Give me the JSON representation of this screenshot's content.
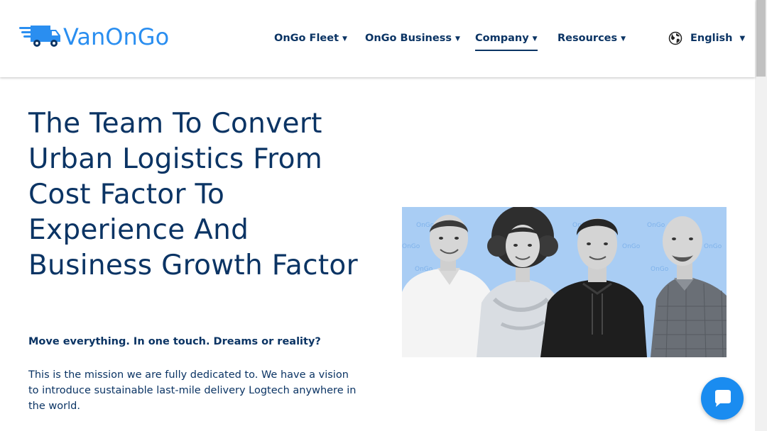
{
  "brand": {
    "name": "VanOnGo",
    "accent": "#2a8ef0",
    "dark": "#0b3464"
  },
  "nav": {
    "items": [
      {
        "label": "OnGo Fleet"
      },
      {
        "label": "OnGo Business"
      },
      {
        "label": "Company",
        "active": true
      },
      {
        "label": "Resources"
      }
    ],
    "language": "English"
  },
  "hero": {
    "title": "The Team To Convert Urban Logistics From Cost Factor To Experience And Business Growth Factor",
    "tagline": "Move everything. In one touch. Dreams or reality?",
    "mission": "This is the mission we are fully dedicated to. We have a vision to introduce sustainable last-mile delivery Logtech anywhere in the world.",
    "team_photo_watermark": "OnGo"
  },
  "icons": {
    "logo": "delivery-truck-icon",
    "globe": "globe-icon",
    "chat": "chat-bubble-icon"
  }
}
